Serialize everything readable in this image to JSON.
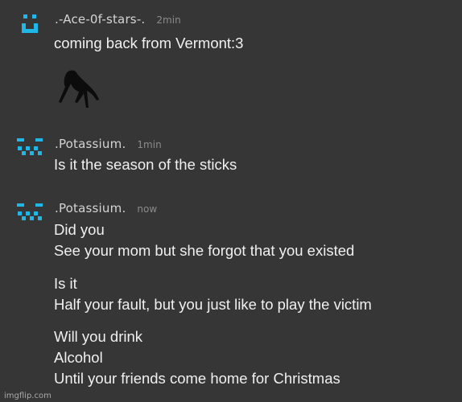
{
  "messages": [
    {
      "username": ".-Ace-0f-stars-.",
      "timestamp": "2min",
      "lines": [
        "coming back from Vermont:3"
      ],
      "sticker": "shadow-creature-sticker"
    },
    {
      "username": ".Potassium.",
      "timestamp": "1min",
      "lines": [
        "Is it the season of the sticks"
      ]
    },
    {
      "username": ".Potassium.",
      "timestamp": "now",
      "lines": [
        "Did you",
        "See your mom but she forgot that you existed",
        "Is it",
        "Half your fault, but you just like to play the victim",
        "Will you drink",
        "Alcohol",
        "Until your friends come home for Christmas"
      ]
    }
  ],
  "avatar_color": "#1fb6e8",
  "watermark": "imgflip.com"
}
